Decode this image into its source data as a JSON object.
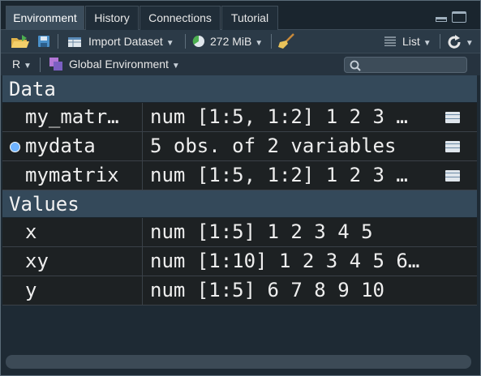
{
  "tabs": [
    {
      "label": "Environment",
      "active": true
    },
    {
      "label": "History",
      "active": false
    },
    {
      "label": "Connections",
      "active": false
    },
    {
      "label": "Tutorial",
      "active": false
    }
  ],
  "toolbar": {
    "import_dataset_label": "Import Dataset",
    "memory_label": "272 MiB",
    "view_mode_label": "List"
  },
  "env_bar": {
    "language_label": "R",
    "environment_label": "Global Environment",
    "search_placeholder": ""
  },
  "sections": {
    "data": {
      "title": "Data",
      "rows": [
        {
          "name": "my_matr…",
          "value": "num [1:5, 1:2] 1 2 3 …",
          "has_viewer": true,
          "expandable": false
        },
        {
          "name": "mydata",
          "value": "5 obs. of 2 variables",
          "has_viewer": true,
          "expandable": true
        },
        {
          "name": "mymatrix",
          "value": "num [1:5, 1:2] 1 2 3 …",
          "has_viewer": true,
          "expandable": false
        }
      ]
    },
    "values": {
      "title": "Values",
      "rows": [
        {
          "name": "x",
          "value": "num [1:5] 1 2 3 4 5"
        },
        {
          "name": "xy",
          "value": "num [1:10] 1 2 3 4 5 6…"
        },
        {
          "name": "y",
          "value": "num [1:5] 6 7 8 9 10"
        }
      ]
    }
  },
  "colors": {
    "accent": "#6fb3ff",
    "section_header": "#34495a",
    "row_bg": "#1d2123"
  },
  "icons": [
    "open-folder-icon",
    "save-icon",
    "import-dataset-icon",
    "memory-pie-icon",
    "broom-icon",
    "list-icon",
    "refresh-icon",
    "r-language-icon",
    "environment-icon",
    "search-icon",
    "grid-view-icon",
    "expand-icon",
    "minimize-icon",
    "maximize-icon"
  ]
}
